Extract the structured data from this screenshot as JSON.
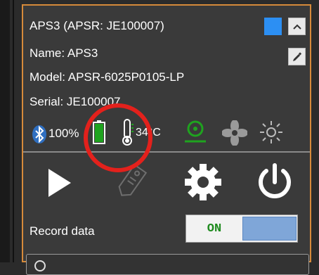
{
  "device": {
    "title": "APS3 (APSR: JE100007)",
    "name_line": "Name:  APS3",
    "model_line": "Model: APSR-6025P0105-LP",
    "serial_line": "Serial:  JE100007",
    "swatch_color": "#2c8ff3"
  },
  "status": {
    "battery_percent": "100%",
    "temperature": "34°C",
    "battery_level": 1.0
  },
  "controls": {
    "record_label": "Record data",
    "toggle_on_label": "ON"
  },
  "icons": {
    "collapse": "chevron-up-icon",
    "edit": "pencil-icon",
    "bluetooth": "bluetooth-icon",
    "battery": "battery-icon",
    "thermometer": "thermometer-icon",
    "sensor": "sensor-icon",
    "fan": "fan-icon",
    "light": "light-icon",
    "play": "play-icon",
    "tag": "tag-icon",
    "settings": "gear-icon",
    "power": "power-icon"
  },
  "annotation_color": "#e3211c"
}
